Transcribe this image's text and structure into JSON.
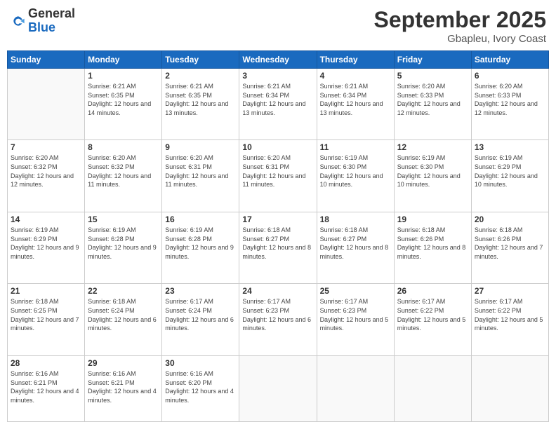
{
  "logo": {
    "general": "General",
    "blue": "Blue"
  },
  "header": {
    "month": "September 2025",
    "location": "Gbapleu, Ivory Coast"
  },
  "weekdays": [
    "Sunday",
    "Monday",
    "Tuesday",
    "Wednesday",
    "Thursday",
    "Friday",
    "Saturday"
  ],
  "days": [
    {
      "date": "",
      "sunrise": "",
      "sunset": "",
      "daylight": ""
    },
    {
      "date": "1",
      "sunrise": "6:21 AM",
      "sunset": "6:35 PM",
      "daylight": "12 hours and 14 minutes."
    },
    {
      "date": "2",
      "sunrise": "6:21 AM",
      "sunset": "6:35 PM",
      "daylight": "12 hours and 13 minutes."
    },
    {
      "date": "3",
      "sunrise": "6:21 AM",
      "sunset": "6:34 PM",
      "daylight": "12 hours and 13 minutes."
    },
    {
      "date": "4",
      "sunrise": "6:21 AM",
      "sunset": "6:34 PM",
      "daylight": "12 hours and 13 minutes."
    },
    {
      "date": "5",
      "sunrise": "6:20 AM",
      "sunset": "6:33 PM",
      "daylight": "12 hours and 12 minutes."
    },
    {
      "date": "6",
      "sunrise": "6:20 AM",
      "sunset": "6:33 PM",
      "daylight": "12 hours and 12 minutes."
    },
    {
      "date": "7",
      "sunrise": "6:20 AM",
      "sunset": "6:32 PM",
      "daylight": "12 hours and 12 minutes."
    },
    {
      "date": "8",
      "sunrise": "6:20 AM",
      "sunset": "6:32 PM",
      "daylight": "12 hours and 11 minutes."
    },
    {
      "date": "9",
      "sunrise": "6:20 AM",
      "sunset": "6:31 PM",
      "daylight": "12 hours and 11 minutes."
    },
    {
      "date": "10",
      "sunrise": "6:20 AM",
      "sunset": "6:31 PM",
      "daylight": "12 hours and 11 minutes."
    },
    {
      "date": "11",
      "sunrise": "6:19 AM",
      "sunset": "6:30 PM",
      "daylight": "12 hours and 10 minutes."
    },
    {
      "date": "12",
      "sunrise": "6:19 AM",
      "sunset": "6:30 PM",
      "daylight": "12 hours and 10 minutes."
    },
    {
      "date": "13",
      "sunrise": "6:19 AM",
      "sunset": "6:29 PM",
      "daylight": "12 hours and 10 minutes."
    },
    {
      "date": "14",
      "sunrise": "6:19 AM",
      "sunset": "6:29 PM",
      "daylight": "12 hours and 9 minutes."
    },
    {
      "date": "15",
      "sunrise": "6:19 AM",
      "sunset": "6:28 PM",
      "daylight": "12 hours and 9 minutes."
    },
    {
      "date": "16",
      "sunrise": "6:19 AM",
      "sunset": "6:28 PM",
      "daylight": "12 hours and 9 minutes."
    },
    {
      "date": "17",
      "sunrise": "6:18 AM",
      "sunset": "6:27 PM",
      "daylight": "12 hours and 8 minutes."
    },
    {
      "date": "18",
      "sunrise": "6:18 AM",
      "sunset": "6:27 PM",
      "daylight": "12 hours and 8 minutes."
    },
    {
      "date": "19",
      "sunrise": "6:18 AM",
      "sunset": "6:26 PM",
      "daylight": "12 hours and 8 minutes."
    },
    {
      "date": "20",
      "sunrise": "6:18 AM",
      "sunset": "6:26 PM",
      "daylight": "12 hours and 7 minutes."
    },
    {
      "date": "21",
      "sunrise": "6:18 AM",
      "sunset": "6:25 PM",
      "daylight": "12 hours and 7 minutes."
    },
    {
      "date": "22",
      "sunrise": "6:18 AM",
      "sunset": "6:24 PM",
      "daylight": "12 hours and 6 minutes."
    },
    {
      "date": "23",
      "sunrise": "6:17 AM",
      "sunset": "6:24 PM",
      "daylight": "12 hours and 6 minutes."
    },
    {
      "date": "24",
      "sunrise": "6:17 AM",
      "sunset": "6:23 PM",
      "daylight": "12 hours and 6 minutes."
    },
    {
      "date": "25",
      "sunrise": "6:17 AM",
      "sunset": "6:23 PM",
      "daylight": "12 hours and 5 minutes."
    },
    {
      "date": "26",
      "sunrise": "6:17 AM",
      "sunset": "6:22 PM",
      "daylight": "12 hours and 5 minutes."
    },
    {
      "date": "27",
      "sunrise": "6:17 AM",
      "sunset": "6:22 PM",
      "daylight": "12 hours and 5 minutes."
    },
    {
      "date": "28",
      "sunrise": "6:16 AM",
      "sunset": "6:21 PM",
      "daylight": "12 hours and 4 minutes."
    },
    {
      "date": "29",
      "sunrise": "6:16 AM",
      "sunset": "6:21 PM",
      "daylight": "12 hours and 4 minutes."
    },
    {
      "date": "30",
      "sunrise": "6:16 AM",
      "sunset": "6:20 PM",
      "daylight": "12 hours and 4 minutes."
    }
  ]
}
